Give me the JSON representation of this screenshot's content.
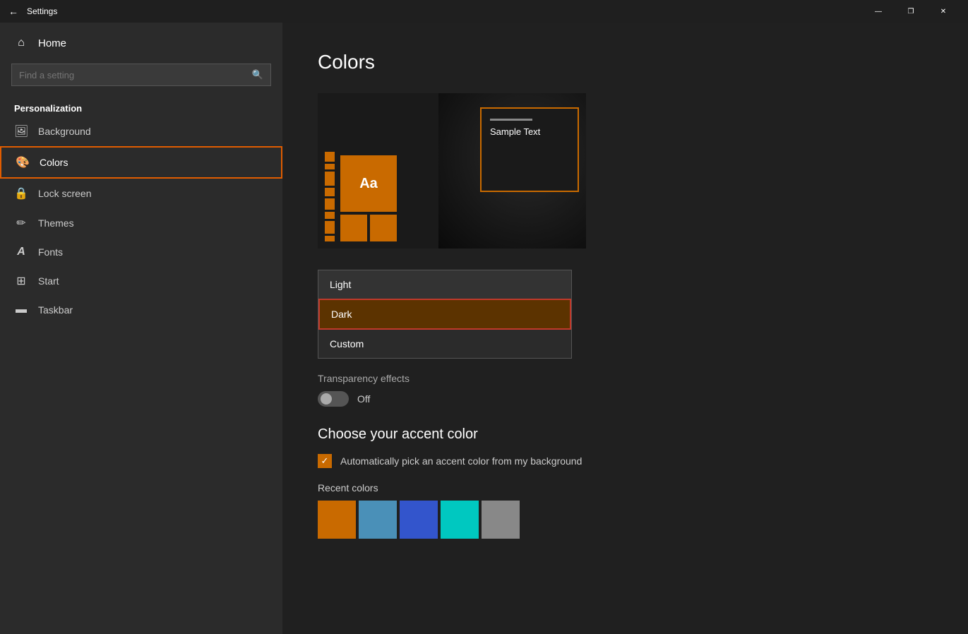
{
  "titlebar": {
    "back_label": "←",
    "title": "Settings",
    "minimize": "—",
    "maximize": "❐",
    "close": "✕"
  },
  "sidebar": {
    "home_label": "Home",
    "search_placeholder": "Find a setting",
    "section_title": "Personalization",
    "items": [
      {
        "id": "background",
        "label": "Background",
        "icon": "🖼"
      },
      {
        "id": "colors",
        "label": "Colors",
        "icon": "🎨",
        "active": true
      },
      {
        "id": "lock-screen",
        "label": "Lock screen",
        "icon": "🔒"
      },
      {
        "id": "themes",
        "label": "Themes",
        "icon": "✏"
      },
      {
        "id": "fonts",
        "label": "Fonts",
        "icon": "A"
      },
      {
        "id": "start",
        "label": "Start",
        "icon": "⊞"
      },
      {
        "id": "taskbar",
        "label": "Taskbar",
        "icon": "▬"
      }
    ]
  },
  "content": {
    "page_title": "Colors",
    "dropdown_options": [
      {
        "id": "light",
        "label": "Light"
      },
      {
        "id": "dark",
        "label": "Dark",
        "selected": true
      },
      {
        "id": "custom",
        "label": "Custom"
      }
    ],
    "transparency_label": "Transparency effects",
    "transparency_state": "Off",
    "accent_title": "Choose your accent color",
    "accent_checkbox_label": "Automatically pick an accent color from my background",
    "recent_colors_label": "Recent colors",
    "recent_colors": [
      "#c96a00",
      "#4a90b8",
      "#3355cc",
      "#00c8c0",
      "#888888"
    ],
    "sample_text": "Sample Text"
  }
}
